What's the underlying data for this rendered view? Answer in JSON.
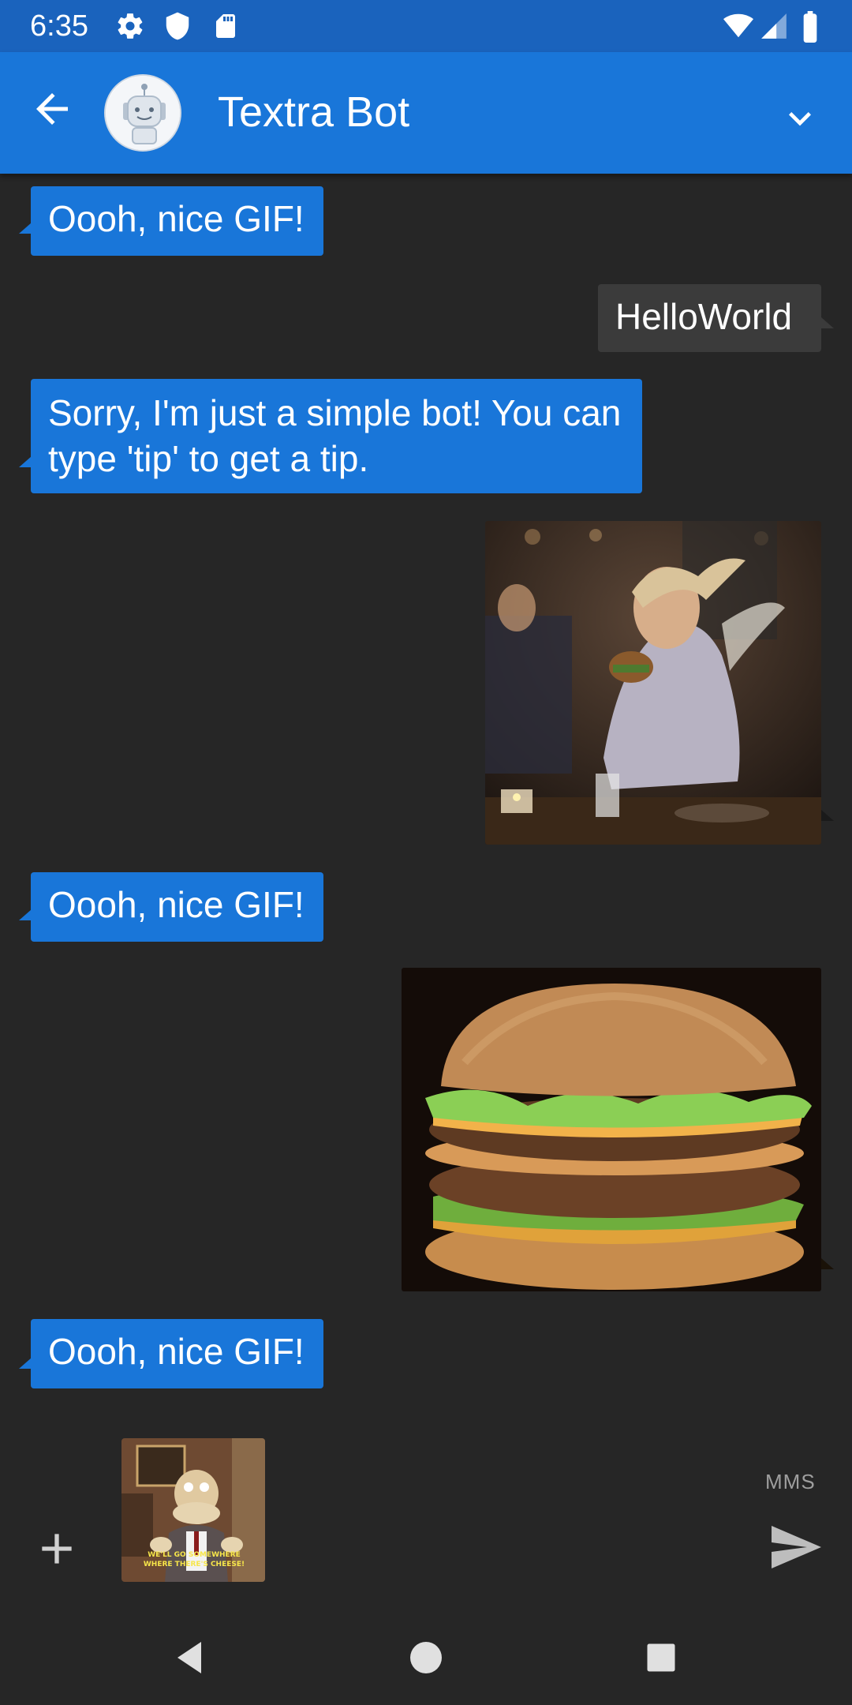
{
  "status_bar": {
    "time": "6:35"
  },
  "header": {
    "title": "Textra Bot"
  },
  "messages": [
    {
      "direction": "incoming",
      "text": "Oooh, nice GIF!"
    },
    {
      "direction": "outgoing",
      "text": "HelloWorld"
    },
    {
      "direction": "incoming",
      "text": "Sorry, I'm just a simple bot! You can type 'tip' to get a tip."
    },
    {
      "direction": "outgoing",
      "media": "gif-woman-eating-burger"
    },
    {
      "direction": "incoming",
      "text": "Oooh, nice GIF!"
    },
    {
      "direction": "outgoing",
      "media": "gif-big-burger"
    },
    {
      "direction": "incoming",
      "text": "Oooh, nice GIF!"
    }
  ],
  "compose": {
    "attachment_caption": "WE'LL GO SOMEWHERE WHERE THERE'S CHEESE!",
    "mode_label": "MMS"
  },
  "colors": {
    "accent": "#1976d9",
    "status_bar": "#1a63bd",
    "background": "#262626",
    "outgoing_bubble": "#3b3b3b"
  }
}
